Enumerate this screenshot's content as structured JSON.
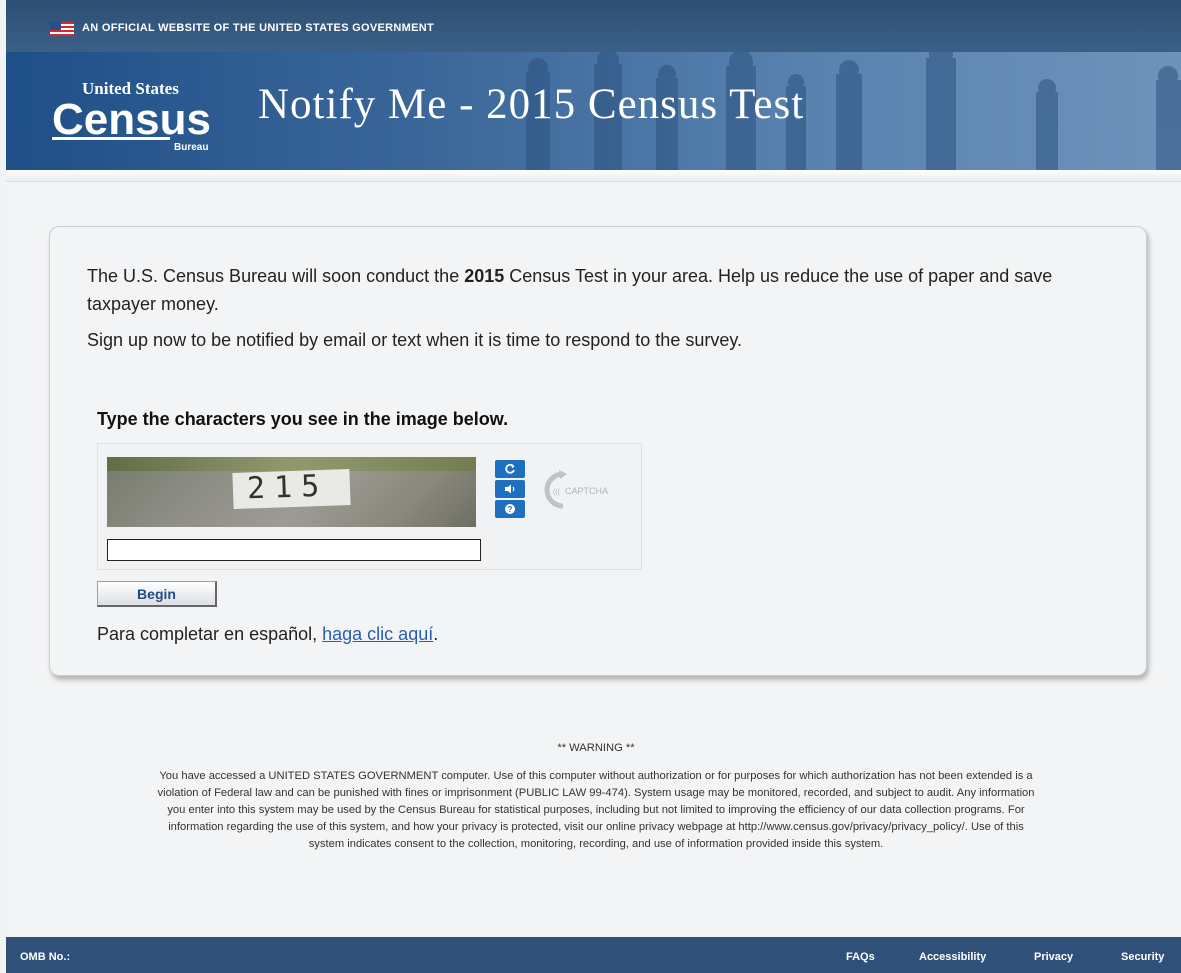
{
  "gov_banner": {
    "text": "AN OFFICIAL WEBSITE OF THE UNITED STATES GOVERNMENT"
  },
  "header": {
    "logo_top": "United States",
    "logo_main": "Census",
    "logo_bottom": "Bureau",
    "title": "Notify Me - 2015 Census Test"
  },
  "intro": {
    "line1_before": "The U.S. Census Bureau will soon conduct the ",
    "year": "2015",
    "line1_after": " Census Test in your area. Help us reduce the use of paper and save taxpayer money.",
    "line2": "Sign up now to be notified by email or text when it is time to respond to the survey."
  },
  "captcha": {
    "heading": "Type the characters you see in the image below.",
    "image_text": "215",
    "input_value": "",
    "provider": "CAPTCHA",
    "refresh_icon": "refresh-icon",
    "audio_icon": "audio-icon",
    "help_icon": "help-icon"
  },
  "begin_button": {
    "label": "Begin"
  },
  "spanish": {
    "text": "Para completar en español, ",
    "link": "haga clic aquí",
    "after": "."
  },
  "warning": {
    "heading": "** WARNING **",
    "body": "You have accessed a UNITED STATES GOVERNMENT computer. Use of this computer without authorization or for purposes for which authorization has not been extended is a violation of Federal law and can be punished with fines or imprisonment (PUBLIC LAW 99-474). System usage may be monitored, recorded, and subject to audit. Any information you enter into this system may be used by the Census Bureau for statistical purposes, including but not limited to improving the efficiency of our data collection programs. For information regarding the use of this system, and how your privacy is protected, visit our online privacy webpage at http://www.census.gov/privacy/privacy_policy/. Use of this system indicates consent to the collection, monitoring, recording, and use of information provided inside this system."
  },
  "footer": {
    "omb": "OMB No.:",
    "links": [
      "FAQs",
      "Accessibility",
      "Privacy",
      "Security"
    ]
  },
  "colors": {
    "banner": "#2f5179",
    "link": "#2a5cb3",
    "captcha_button": "#1e6fc0"
  }
}
